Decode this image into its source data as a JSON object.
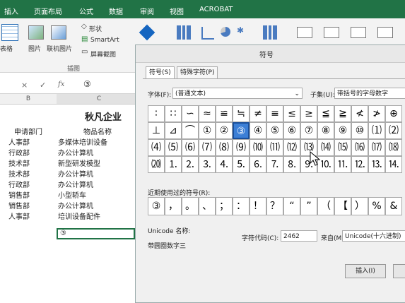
{
  "ribbon": {
    "tabs": [
      "插入",
      "页面布局",
      "公式",
      "数据",
      "审阅",
      "视图",
      "ACROBAT"
    ],
    "buttons": {
      "table": "表格",
      "picture": "图片",
      "online_picture": "联机图片",
      "shapes": "形状",
      "smartart": "SmartArt",
      "screenshot": "屏幕截图"
    },
    "group_label": "插图"
  },
  "formula_bar": {
    "cancel": "×",
    "enter": "✓",
    "fx": "fx",
    "value": "③"
  },
  "sheet": {
    "col_b": "B",
    "col_c": "C",
    "title": "秋凡企业",
    "headers": [
      "申请部门",
      "物品名称"
    ],
    "rows": [
      {
        "dept": "人事部",
        "item": "多媒体培训设备"
      },
      {
        "dept": "行政部",
        "item": "办公计算机"
      },
      {
        "dept": "技术部",
        "item": "新型研发模型"
      },
      {
        "dept": "技术部",
        "item": "办公计算机"
      },
      {
        "dept": "行政部",
        "item": "办公计算机"
      },
      {
        "dept": "销售部",
        "item": "小型轿车"
      },
      {
        "dept": "销售部",
        "item": "办公计算机"
      },
      {
        "dept": "人事部",
        "item": "培训设备配件"
      }
    ],
    "active_cell": "③"
  },
  "dialog": {
    "title": "符号",
    "tab_symbols": "符号(S)",
    "tab_special": "特殊字符(P)",
    "font_label": "字体(F):",
    "font_value": "(普通文本)",
    "subset_label": "子集(U):",
    "subset_value": "带括号的字母数字",
    "symbols_row1": [
      "∶",
      "∷",
      "∽",
      "≈",
      "≌",
      "≒",
      "≠",
      "≡",
      "≤",
      "≥",
      "≦",
      "≧",
      "≮",
      "≯",
      "⊕"
    ],
    "symbols_row2": [
      "⊥",
      "⊿",
      "⌒",
      "①",
      "②",
      "③",
      "④",
      "⑤",
      "⑥",
      "⑦",
      "⑧",
      "⑨",
      "⑩",
      "⑴",
      "⑵"
    ],
    "symbols_row3": [
      "⑷",
      "⑸",
      "⑹",
      "⑺",
      "⑻",
      "⑼",
      "⑽",
      "⑾",
      "⑿",
      "⒀",
      "⒁",
      "⒂",
      "⒃",
      "⒄",
      "⒅"
    ],
    "symbols_row4": [
      "⒇",
      "⒈",
      "⒉",
      "⒊",
      "⒋",
      "⒌",
      "⒍",
      "⒎",
      "⒏",
      "⒐",
      "⒑",
      "⒒",
      "⒓",
      "⒔",
      "⒕"
    ],
    "recent_label": "近期使用过的符号(R):",
    "recent_symbols": [
      "③",
      "，",
      "。",
      "、",
      "；",
      "：",
      "！",
      "？",
      "“",
      "”",
      "（",
      "【",
      "）",
      "%",
      "&"
    ],
    "unicode_name_label": "Unicode 名称:",
    "unicode_name_value": "带圆圈数字三",
    "char_code_label": "字符代码(C):",
    "char_code_value": "2462",
    "from_label": "来自(M):",
    "from_value": "Unicode(十六进制)",
    "insert_button": "插入(I)"
  }
}
